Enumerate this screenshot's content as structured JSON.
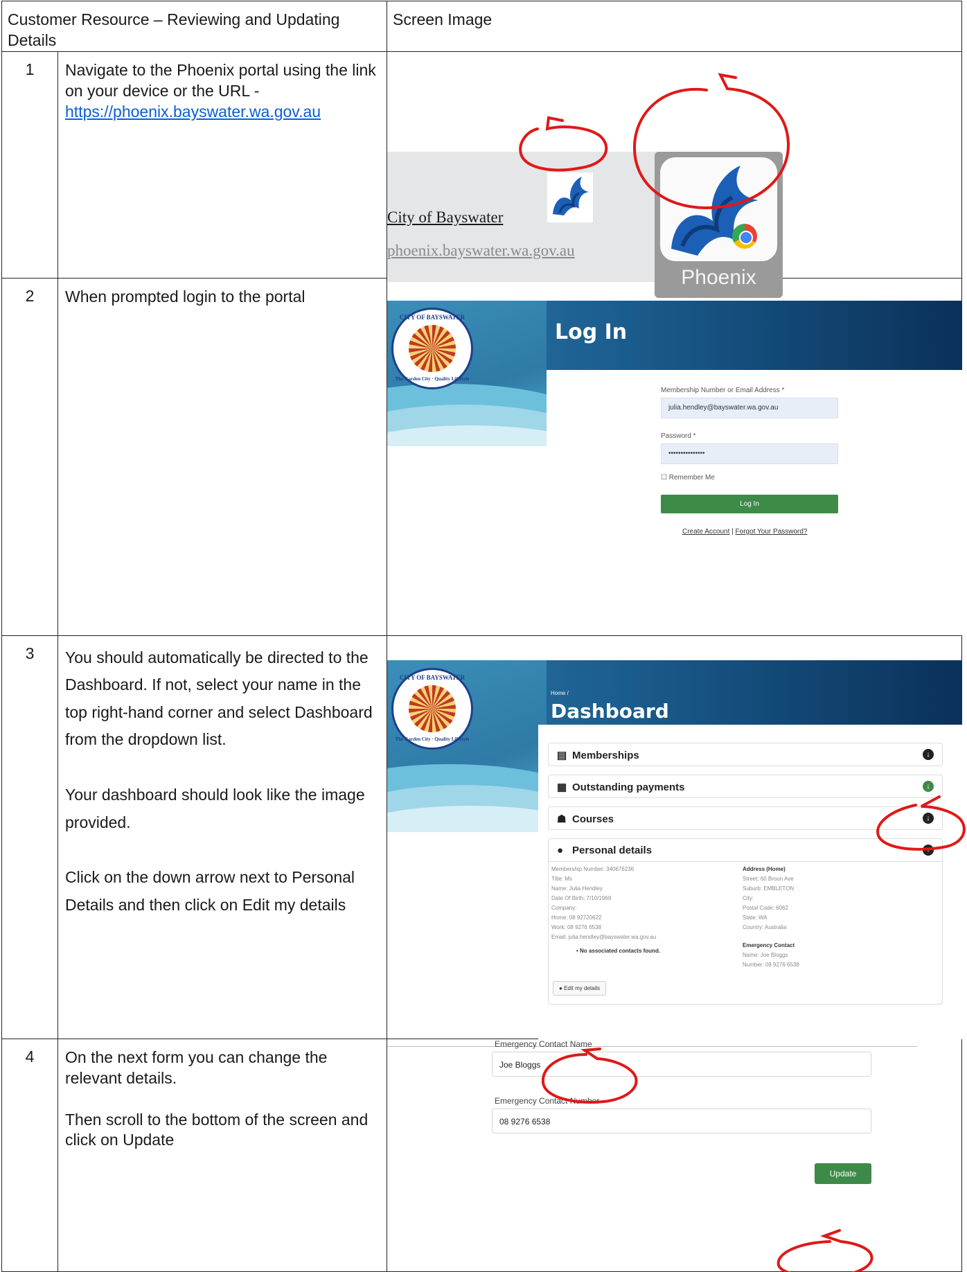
{
  "table": {
    "header_left": "Customer Resource – Reviewing and Updating Details",
    "header_right": "Screen Image"
  },
  "steps": [
    {
      "num": "1",
      "text1": "Navigate to the Phoenix portal using the link on your device or the URL - ",
      "link": "https://phoenix.bayswater.wa.gov.au"
    },
    {
      "num": "2",
      "text1": "When prompted login to the portal"
    },
    {
      "num": "3",
      "text1": "You should automatically be directed to the Dashboard.  If not, select your name in the top right-hand corner and select Dashboard from the dropdown list.",
      "text2": "Your dashboard should look like the image provided.",
      "text3": "Click on the down arrow next to Personal Details and then click on Edit my details"
    },
    {
      "num": "4",
      "text1": "On the next form you can change the relevant details.",
      "text2": "Then scroll to the bottom of the screen and click on Update"
    }
  ],
  "shot1": {
    "bookmark_title": "City of Bayswater",
    "bookmark_url": "phoenix.bayswater.wa.gov.au",
    "app_label": "Phoenix"
  },
  "crest": {
    "top_text": "CITY OF BAYSWATER",
    "bottom_text": "The Garden City · Quality Lifestyle"
  },
  "login": {
    "title": "Log In",
    "email_label": "Membership Number or Email Address *",
    "email_value": "julia.hendley@bayswater.wa.gov.au",
    "password_label": "Password *",
    "password_value": "•••••••••••••••",
    "remember": "Remember Me",
    "button": "Log In",
    "create_account": "Create Account",
    "separator": "|",
    "forgot": "Forgot Your Password?"
  },
  "dashboard": {
    "breadcrumb": "Home  /",
    "title": "Dashboard",
    "sections": [
      {
        "label": "Memberships",
        "icon": "id-card-icon",
        "arrow": "down"
      },
      {
        "label": "Outstanding payments",
        "icon": "receipt-icon",
        "arrow": "down"
      },
      {
        "label": "Courses",
        "icon": "people-icon",
        "arrow": "down"
      },
      {
        "label": "Personal details",
        "icon": "user-icon",
        "arrow": "up"
      }
    ],
    "details_left": [
      "Membership Number: 340676236",
      "Title: Ms",
      "Name: Julia Hendley",
      "Date Of Birth: 7/10/1969",
      "Company:",
      "Home: 08 92720622",
      "Work: 08 9276 6538",
      "Email: julia.hendley@bayswater.wa.gov.au"
    ],
    "no_contacts": "No associated contacts found.",
    "address_heading": "Address (Home)",
    "details_right": [
      "Street: 60 Broun Ave",
      "Suburb: EMBLETON",
      "City:",
      "Postal Code: 6062",
      "State: WA",
      "Country: Australia"
    ],
    "emergency_heading": "Emergency Contact",
    "emergency_name": "Name: Joe Bloggs",
    "emergency_number": "Number: 08 9276 6538",
    "edit_button": "Edit my details"
  },
  "form4": {
    "name_label": "Emergency Contact Name",
    "name_value": "Joe Bloggs",
    "number_label": "Emergency Contact Number",
    "number_value": "08 9276 6538",
    "update_button": "Update"
  },
  "colors": {
    "annotation": "#e01818",
    "link": "#0b5ed7",
    "button_green": "#3e8a48",
    "banner_dark": "#0a3159",
    "banner_light": "#2a78a6"
  }
}
